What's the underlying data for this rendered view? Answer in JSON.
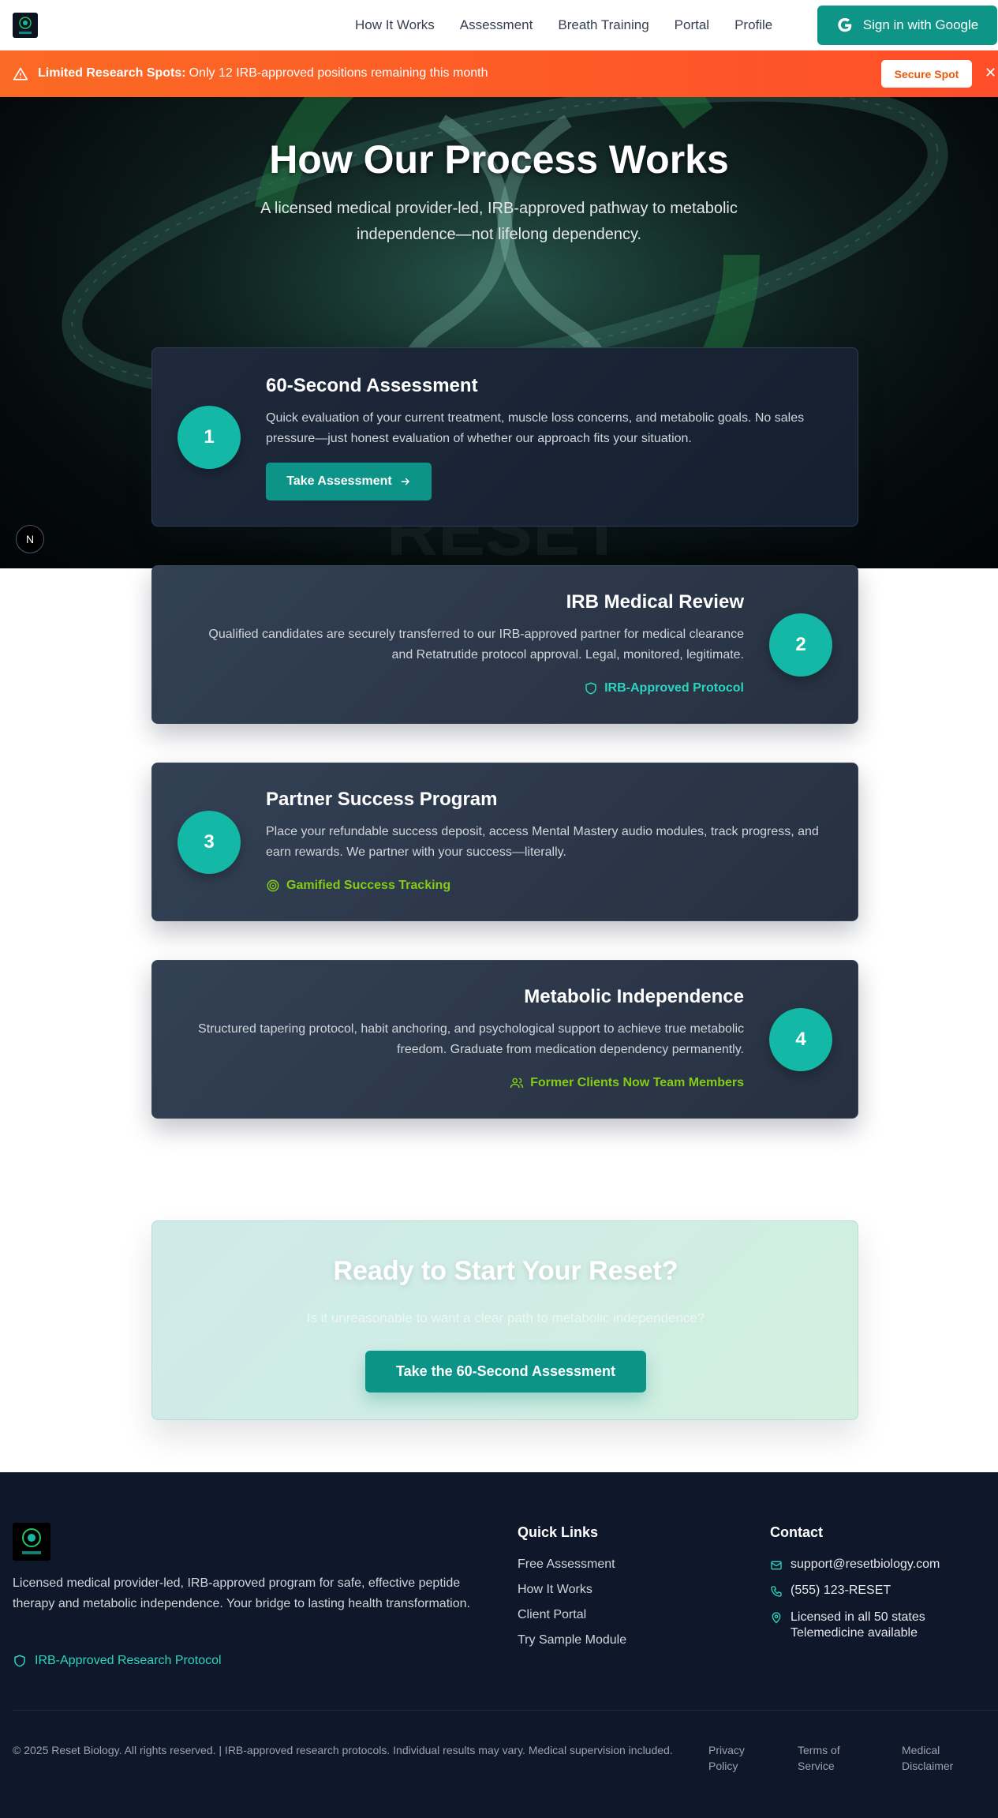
{
  "nav": {
    "links": [
      "How It Works",
      "Assessment",
      "Breath Training",
      "Portal",
      "Profile"
    ],
    "signin_label": "Sign in with Google"
  },
  "banner": {
    "bold": "Limited Research Spots:",
    "text": "Only 12 IRB-approved positions remaining this month",
    "button": "Secure Spot",
    "close": "✕"
  },
  "hero": {
    "title": "How Our Process Works",
    "subtitle": "A licensed medical provider-led, IRB-approved pathway to metabolic independence—not lifelong dependency.",
    "badge": "N"
  },
  "steps": [
    {
      "number": "1",
      "title": "60-Second Assessment",
      "description": "Quick evaluation of your current treatment, muscle loss concerns, and metabolic goals. No sales pressure—just honest evaluation of whether our approach fits your situation.",
      "button": "Take Assessment"
    },
    {
      "number": "2",
      "title": "IRB Medical Review",
      "description": "Qualified candidates are securely transferred to our IRB-approved partner for medical clearance and Retatrutide protocol approval. Legal, monitored, legitimate.",
      "tag": "IRB-Approved Protocol"
    },
    {
      "number": "3",
      "title": "Partner Success Program",
      "description": "Place your refundable success deposit, access Mental Mastery audio modules, track progress, and earn rewards. We partner with your success—literally.",
      "tag": "Gamified Success Tracking"
    },
    {
      "number": "4",
      "title": "Metabolic Independence",
      "description": "Structured tapering protocol, habit anchoring, and psychological support to achieve true metabolic freedom. Graduate from medication dependency permanently.",
      "tag": "Former Clients Now Team Members"
    }
  ],
  "cta": {
    "title": "Ready to Start Your Reset?",
    "subtitle": "Is it unreasonable to want a clear path to metabolic independence?",
    "button": "Take the 60-Second Assessment"
  },
  "footer": {
    "description": "Licensed medical provider-led, IRB-approved program for safe, effective peptide therapy and metabolic independence. Your bridge to lasting health transformation.",
    "irb": "IRB-Approved Research Protocol",
    "quick_links_title": "Quick Links",
    "quick_links": [
      "Free Assessment",
      "How It Works",
      "Client Portal",
      "Try Sample Module"
    ],
    "contact_title": "Contact",
    "email": "support@resetbiology.com",
    "phone": "(555) 123-RESET",
    "license_line1": "Licensed in all 50 states",
    "license_line2": "Telemedicine available",
    "copyright": "© 2025 Reset Biology. All rights reserved. | IRB-approved research protocols. Individual results may vary. Medical supervision included.",
    "legal": [
      "Privacy Policy",
      "Terms of Service",
      "Medical Disclaimer"
    ]
  },
  "colors": {
    "accent": "#0d9488",
    "teal_badge": "#14b8a6",
    "banner": "#ff5a25",
    "footer_bg": "#0f172a",
    "green_tag": "#84cc16"
  }
}
